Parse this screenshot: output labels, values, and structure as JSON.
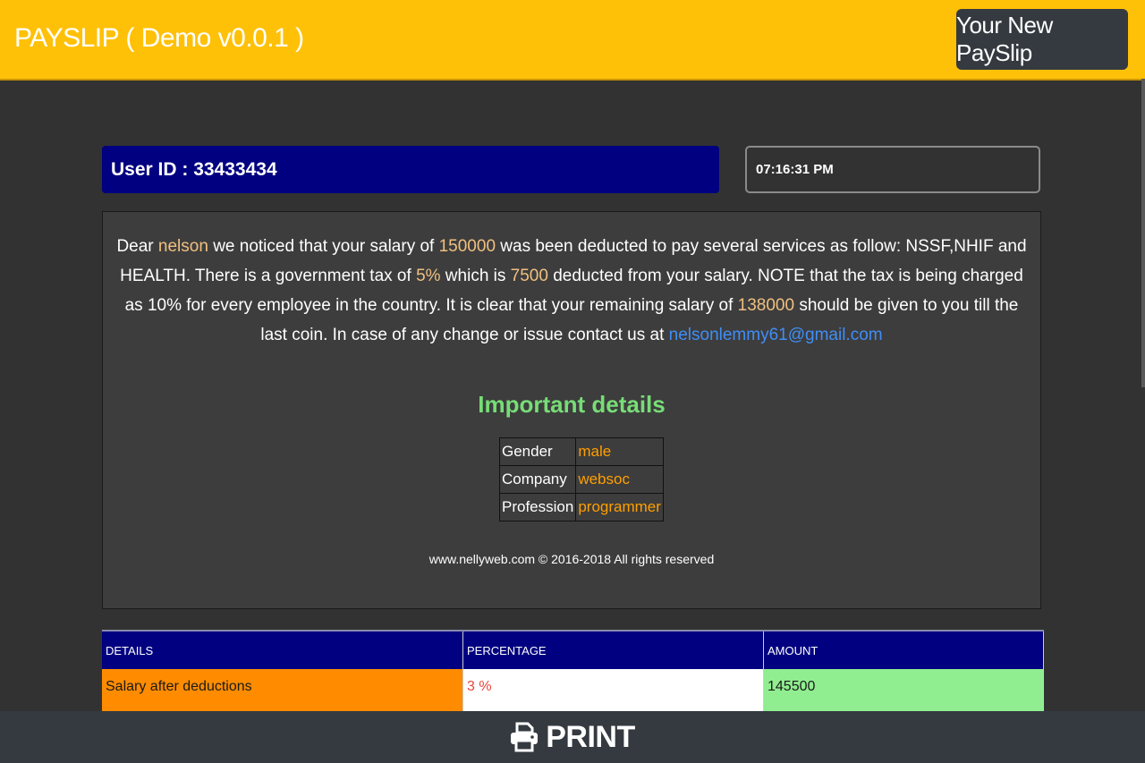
{
  "header": {
    "brand": "PAYSLIP ( Demo v0.0.1 )",
    "new_payslip_label": "Your New PaySlip",
    "bar_color": "#ffc107"
  },
  "user": {
    "id_label": "User ID : 33433434",
    "clock": "07:16:31 PM"
  },
  "letter": {
    "t1": "Dear ",
    "name": "nelson",
    "t2": " we noticed that your salary of ",
    "salary": "150000",
    "t3": " was been deducted to pay several services as follow: NSSF,NHIF and HEALTH. There is a government tax of ",
    "tax_rate": "5%",
    "t4": " which is ",
    "tax_amount": "7500",
    "t5": " deducted from your salary. NOTE that the tax is being charged as 10% for every employee in the country. It is clear that your remaining salary of ",
    "remaining": "138000",
    "t6": " should be given to you till the last coin. In case of any change or issue contact us at ",
    "email": "nelsonlemmy61@gmail.com"
  },
  "details": {
    "title": "Important details",
    "rows": [
      {
        "key": "Gender",
        "value": "male"
      },
      {
        "key": "Company",
        "value": "websoc"
      },
      {
        "key": "Profession",
        "value": "programmer"
      }
    ]
  },
  "footer": {
    "copyright": "www.nellyweb.com © 2016-2018 All rights reserved"
  },
  "salary_table": {
    "headers": [
      "DETAILS",
      "PERCENTAGE",
      "AMOUNT"
    ],
    "rows": [
      {
        "detail": "Salary after deductions",
        "percentage": "3 %",
        "amount": "145500"
      }
    ]
  },
  "print_bar": {
    "label": "PRINT",
    "icon": "printer-icon"
  },
  "colors": {
    "accent": "#ffc107",
    "navy": "#000080",
    "highlight": "#f0c080",
    "detail_value": "#ff9f00",
    "title_green": "#77dd77",
    "link_blue": "#3f8ef7"
  }
}
